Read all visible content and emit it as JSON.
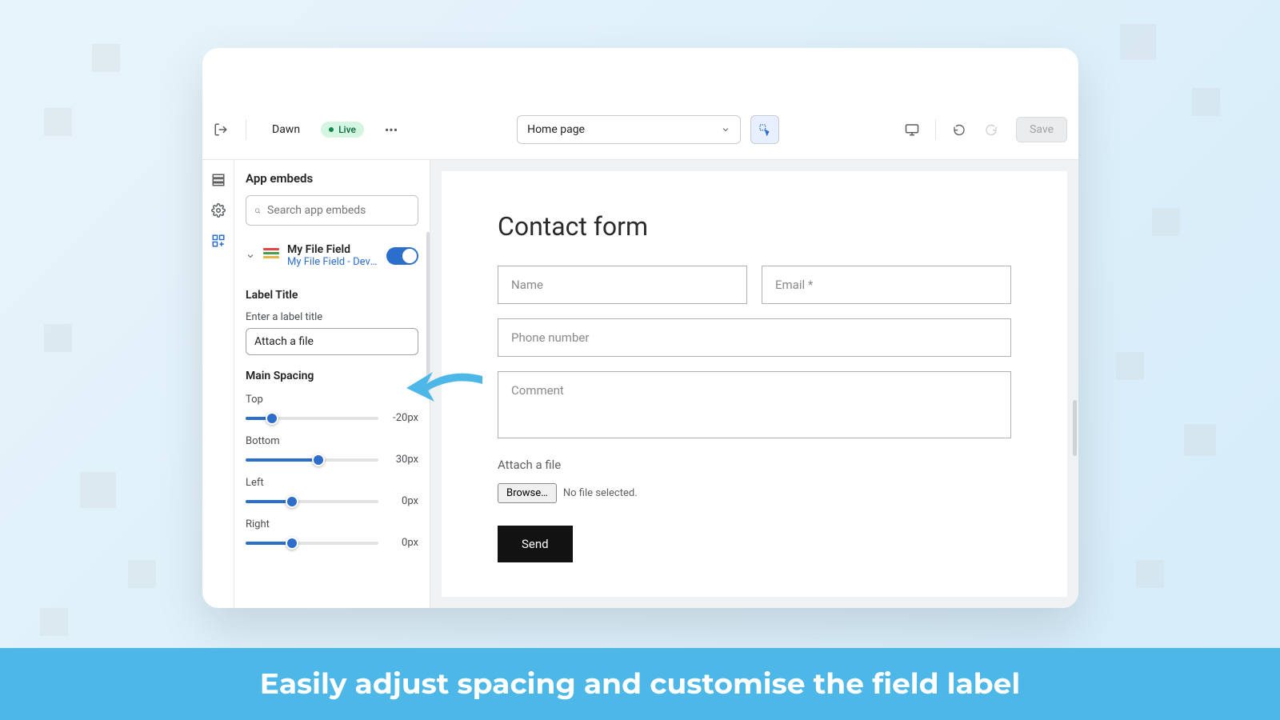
{
  "topbar": {
    "theme": "Dawn",
    "badge": "Live",
    "page": "Home page",
    "save": "Save"
  },
  "sidebar": {
    "title": "App embeds",
    "search_ph": "Search app embeds",
    "embed": {
      "name": "My File Field",
      "sub": "My File Field - Develop…"
    },
    "sec_label_title": "Label Title",
    "sec_label_hint": "Enter a label title",
    "label_value": "Attach a file",
    "sec_spacing": "Main Spacing",
    "sliders": [
      {
        "label": "Top",
        "value": "-20px",
        "fill": 20
      },
      {
        "label": "Bottom",
        "value": "30px",
        "fill": 55
      },
      {
        "label": "Left",
        "value": "0px",
        "fill": 35
      },
      {
        "label": "Right",
        "value": "0px",
        "fill": 35
      }
    ]
  },
  "preview": {
    "title": "Contact form",
    "name_ph": "Name",
    "email_ph": "Email *",
    "phone_ph": "Phone number",
    "comment_ph": "Comment",
    "attach": "Attach a file",
    "browse": "Browse…",
    "nofile": "No file selected.",
    "send": "Send"
  },
  "caption": "Easily adjust spacing and customise the field label"
}
